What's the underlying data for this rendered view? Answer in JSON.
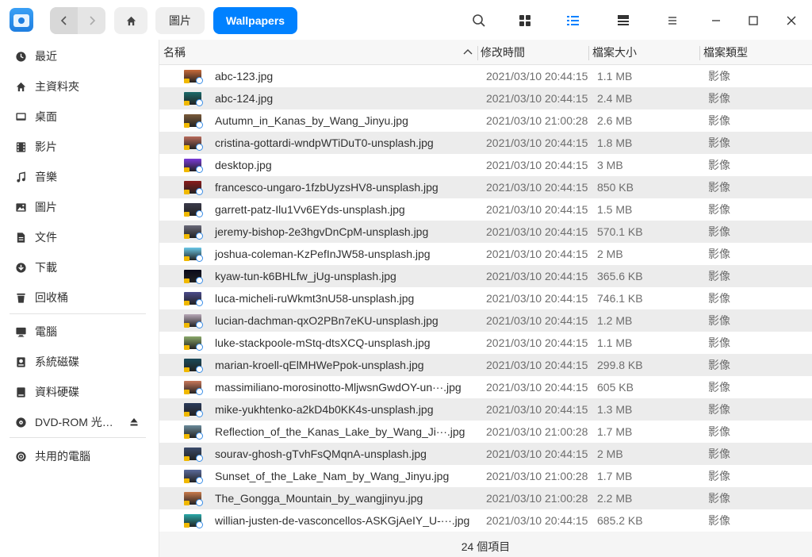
{
  "titlebar": {
    "breadcrumbs": [
      {
        "label": "圖片"
      },
      {
        "label": "Wallpapers"
      }
    ],
    "icons": [
      "app-logo-icon",
      "back-icon",
      "forward-icon",
      "home-icon",
      "search-icon",
      "icon-view-icon",
      "list-view-icon",
      "detail-view-icon",
      "menu-icon",
      "minimize-icon",
      "maximize-icon",
      "close-icon"
    ]
  },
  "sidebar": {
    "items": [
      {
        "label": "最近",
        "icon": "clock-icon"
      },
      {
        "label": "主資料夾",
        "icon": "home-icon"
      },
      {
        "label": "桌面",
        "icon": "desktop-icon"
      },
      {
        "label": "影片",
        "icon": "video-icon"
      },
      {
        "label": "音樂",
        "icon": "music-icon"
      },
      {
        "label": "圖片",
        "icon": "picture-icon"
      },
      {
        "label": "文件",
        "icon": "document-icon"
      },
      {
        "label": "下載",
        "icon": "download-icon"
      },
      {
        "label": "回收桶",
        "icon": "trash-icon"
      }
    ],
    "devices": [
      {
        "label": "電腦",
        "icon": "computer-icon"
      },
      {
        "label": "系統磁碟",
        "icon": "system-disk-icon"
      },
      {
        "label": "資料硬碟",
        "icon": "data-disk-icon"
      },
      {
        "label": "DVD-ROM 光…",
        "icon": "dvd-icon"
      }
    ],
    "network": [
      {
        "label": "共用的電腦",
        "icon": "network-icon"
      }
    ]
  },
  "list": {
    "headers": {
      "name": "名稱",
      "modified": "修改時間",
      "size": "檔案大小",
      "type": "檔案類型"
    },
    "files": [
      {
        "name": "abc-123.jpg",
        "modified": "2021/03/10 20:44:15",
        "size": "1.1 MB",
        "type": "影像",
        "thumb": "#c86a3a"
      },
      {
        "name": "abc-124.jpg",
        "modified": "2021/03/10 20:44:15",
        "size": "2.4 MB",
        "type": "影像",
        "thumb": "#1a6a6a"
      },
      {
        "name": "Autumn_in_Kanas_by_Wang_Jinyu.jpg",
        "modified": "2021/03/10 21:00:28",
        "size": "2.6 MB",
        "type": "影像",
        "thumb": "#7a5a3a"
      },
      {
        "name": "cristina-gottardi-wndpWTiDuT0-unsplash.jpg",
        "modified": "2021/03/10 20:44:15",
        "size": "1.8 MB",
        "type": "影像",
        "thumb": "#b86a5a"
      },
      {
        "name": "desktop.jpg",
        "modified": "2021/03/10 20:44:15",
        "size": "3 MB",
        "type": "影像",
        "thumb": "#7a3ad8"
      },
      {
        "name": "francesco-ungaro-1fzbUyzsHV8-unsplash.jpg",
        "modified": "2021/03/10 20:44:15",
        "size": "850 KB",
        "type": "影像",
        "thumb": "#8a1a1a"
      },
      {
        "name": "garrett-patz-Ilu1Vv6EYds-unsplash.jpg",
        "modified": "2021/03/10 20:44:15",
        "size": "1.5 MB",
        "type": "影像",
        "thumb": "#3a3a4a"
      },
      {
        "name": "jeremy-bishop-2e3hgvDnCpM-unsplash.jpg",
        "modified": "2021/03/10 20:44:15",
        "size": "570.1 KB",
        "type": "影像",
        "thumb": "#6a6a7a"
      },
      {
        "name": "joshua-coleman-KzPefInJW58-unsplash.jpg",
        "modified": "2021/03/10 20:44:15",
        "size": "2 MB",
        "type": "影像",
        "thumb": "#6ac8e8"
      },
      {
        "name": "kyaw-tun-k6BHLfw_jUg-unsplash.jpg",
        "modified": "2021/03/10 20:44:15",
        "size": "365.6 KB",
        "type": "影像",
        "thumb": "#0a0a1a"
      },
      {
        "name": "luca-micheli-ruWkmt3nU58-unsplash.jpg",
        "modified": "2021/03/10 20:44:15",
        "size": "746.1 KB",
        "type": "影像",
        "thumb": "#4a4a8a"
      },
      {
        "name": "lucian-dachman-qxO2PBn7eKU-unsplash.jpg",
        "modified": "2021/03/10 20:44:15",
        "size": "1.2 MB",
        "type": "影像",
        "thumb": "#b8a8b8"
      },
      {
        "name": "luke-stackpoole-mStq-dtsXCQ-unsplash.jpg",
        "modified": "2021/03/10 20:44:15",
        "size": "1.1 MB",
        "type": "影像",
        "thumb": "#8aa86a"
      },
      {
        "name": "marian-kroell-qElMHWePpok-unsplash.jpg",
        "modified": "2021/03/10 20:44:15",
        "size": "299.8 KB",
        "type": "影像",
        "thumb": "#1a4a5a"
      },
      {
        "name": "massimiliano-morosinotto-MljwsnGwdOY-un···.jpg",
        "modified": "2021/03/10 20:44:15",
        "size": "605 KB",
        "type": "影像",
        "thumb": "#c8785a"
      },
      {
        "name": "mike-yukhtenko-a2kD4b0KK4s-unsplash.jpg",
        "modified": "2021/03/10 20:44:15",
        "size": "1.3 MB",
        "type": "影像",
        "thumb": "#2a3a5a"
      },
      {
        "name": "Reflection_of_the_Kanas_Lake_by_Wang_Ji···.jpg",
        "modified": "2021/03/10 21:00:28",
        "size": "1.7 MB",
        "type": "影像",
        "thumb": "#6a8a9a"
      },
      {
        "name": "sourav-ghosh-gTvhFsQMqnA-unsplash.jpg",
        "modified": "2021/03/10 20:44:15",
        "size": "2 MB",
        "type": "影像",
        "thumb": "#3a4a6a"
      },
      {
        "name": "Sunset_of_the_Lake_Nam_by_Wang_Jinyu.jpg",
        "modified": "2021/03/10 21:00:28",
        "size": "1.7 MB",
        "type": "影像",
        "thumb": "#5a6a9a"
      },
      {
        "name": "The_Gongga_Mountain_by_wangjinyu.jpg",
        "modified": "2021/03/10 21:00:28",
        "size": "2.2 MB",
        "type": "影像",
        "thumb": "#c87a4a"
      },
      {
        "name": "willian-justen-de-vasconcellos-ASKGjAeIY_U-···.jpg",
        "modified": "2021/03/10 20:44:15",
        "size": "685.2 KB",
        "type": "影像",
        "thumb": "#2aa8a8"
      }
    ]
  },
  "status": {
    "text": "24 個項目"
  }
}
